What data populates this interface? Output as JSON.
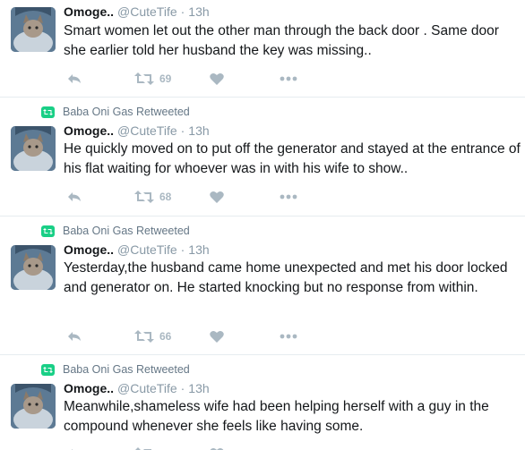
{
  "colors": {
    "retweet_badge": "#19cf86",
    "icon_gray": "#aab8c2",
    "meta_gray": "#8899a6",
    "divider": "#e6ecf0"
  },
  "tweets": [
    {
      "context": null,
      "name": "Omoge..",
      "handle": "@CuteTife",
      "dot": "·",
      "time": "13h",
      "text": "Smart women let out the other man through the back door . Same door she earlier told her husband the key was missing..",
      "retweets": "69",
      "icons": [
        "reply-icon",
        "retweet-icon",
        "like-icon",
        "more-icon"
      ]
    },
    {
      "context": "Baba Oni Gas Retweeted",
      "name": "Omoge..",
      "handle": "@CuteTife",
      "dot": "·",
      "time": "13h",
      "text": "He quickly moved on to put off the generator and stayed at the entrance of his flat waiting for whoever was in with his wife to show..",
      "retweets": "68",
      "icons": [
        "reply-icon",
        "retweet-icon",
        "like-icon",
        "more-icon"
      ]
    },
    {
      "context": "Baba Oni Gas Retweeted",
      "name": "Omoge..",
      "handle": "@CuteTife",
      "dot": "·",
      "time": "13h",
      "text": "Yesterday,the husband came home unexpected and met his door locked and generator on. He started knocking but no response from within.",
      "retweets": "66",
      "icons": [
        "reply-icon",
        "retweet-icon",
        "like-icon",
        "more-icon"
      ]
    },
    {
      "context": "Baba Oni Gas Retweeted",
      "name": "Omoge..",
      "handle": "@CuteTife",
      "dot": "·",
      "time": "13h",
      "text": "Meanwhile,shameless wife had been helping herself with a guy in the compound whenever she feels like having some.",
      "retweets": "",
      "icons": [
        "reply-icon",
        "retweet-icon",
        "like-icon",
        "more-icon"
      ]
    }
  ]
}
